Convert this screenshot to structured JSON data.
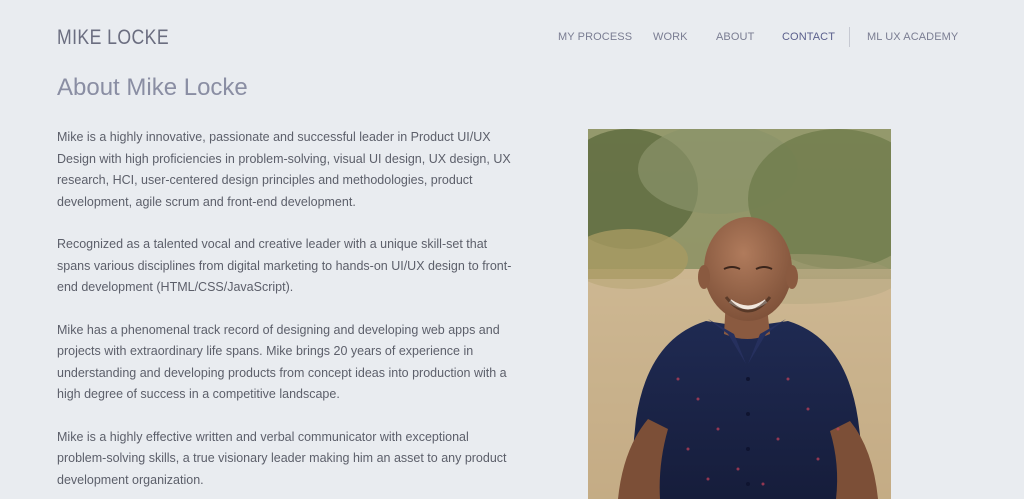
{
  "header": {
    "logo": "MIKE LOCKE",
    "nav": [
      {
        "label": "MY PROCESS"
      },
      {
        "label": "WORK"
      },
      {
        "label": "ABOUT"
      },
      {
        "label": "CONTACT"
      },
      {
        "label": "ML UX ACADEMY"
      }
    ]
  },
  "main": {
    "title": "About Mike Locke",
    "paragraphs": [
      "Mike is a highly innovative, passionate and successful leader in Product UI/UX Design with high proficiencies in problem-solving, visual UI design, UX design, UX research, HCI, user-centered design principles and methodologies, product development, agile scrum and front-end development.",
      "Recognized as a talented vocal and creative leader with a unique skill-set that spans various disciplines from digital marketing to hands-on UI/UX design to front-end development (HTML/CSS/JavaScript).",
      "Mike has a phenomenal track record of designing and developing web apps and projects with extraordinary life spans. Mike brings 20 years of experience in understanding and developing products from concept ideas into production with a high degree of success in a competitive landscape.",
      "Mike is a highly effective written and verbal communicator with exceptional problem-solving skills, a true visionary leader making him an asset to any product development organization."
    ]
  },
  "colors": {
    "background": "#e9ecf0",
    "logo": "#6b6e80",
    "nav": "#7a7d92",
    "title": "#8a8ea3",
    "body_text": "#5c5f6a"
  },
  "photo": {
    "subject": "portrait photo of a smiling bald man in a navy patterned button-up shirt, outdoors"
  }
}
